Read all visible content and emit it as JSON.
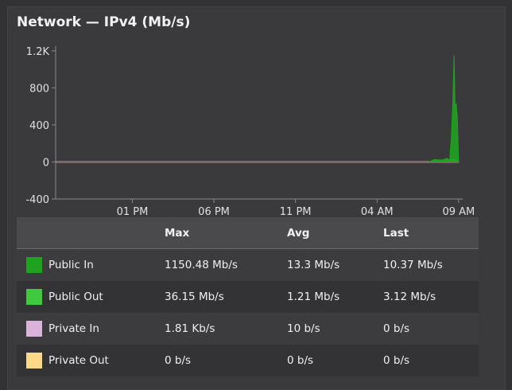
{
  "panel": {
    "title": "Network — IPv4 (Mb/s)"
  },
  "chart_data": {
    "type": "area",
    "title": "Network — IPv4 (Mb/s)",
    "ylim": [
      -400,
      1250
    ],
    "y_ticks": [
      "1.2K",
      "800",
      "400",
      "0",
      "-400"
    ],
    "y_tick_values": [
      1200,
      800,
      400,
      0,
      -400
    ],
    "x_ticks": [
      "01 PM",
      "06 PM",
      "11 PM",
      "04 AM",
      "09 AM"
    ],
    "x_tick_hours": [
      13,
      18,
      23,
      28,
      33
    ],
    "x_range_hours": [
      8.3,
      33.25
    ],
    "grid": false,
    "series": [
      {
        "name": "Public In",
        "color": "#1fa31f",
        "points": [
          [
            8.3,
            0
          ],
          [
            31.2,
            0
          ],
          [
            31.5,
            25
          ],
          [
            32.0,
            20
          ],
          [
            32.3,
            40
          ],
          [
            32.45,
            10
          ],
          [
            32.55,
            250
          ],
          [
            32.65,
            650
          ],
          [
            32.72,
            1150
          ],
          [
            32.78,
            600
          ],
          [
            32.85,
            630
          ],
          [
            32.92,
            480
          ],
          [
            33.0,
            0
          ]
        ]
      },
      {
        "name": "Public Out",
        "color": "#3ec93e",
        "points": [
          [
            8.3,
            0
          ],
          [
            31.2,
            0
          ],
          [
            31.5,
            18
          ],
          [
            32.0,
            14
          ],
          [
            32.5,
            25
          ],
          [
            32.7,
            34
          ],
          [
            33.0,
            8
          ]
        ]
      },
      {
        "name": "Private In",
        "color": "#d9b3d9",
        "points": [
          [
            8.3,
            0
          ],
          [
            33.0,
            0
          ]
        ]
      },
      {
        "name": "Private Out",
        "color": "#ffd98a",
        "points": [
          [
            8.3,
            0
          ],
          [
            33.0,
            0
          ]
        ]
      }
    ]
  },
  "legend": {
    "headers": [
      "",
      "Max",
      "Avg",
      "Last"
    ],
    "rows": [
      {
        "name": "Public In",
        "color": "#1fa31f",
        "max": "1150.48 Mb/s",
        "avg": "13.3 Mb/s",
        "last": "10.37 Mb/s"
      },
      {
        "name": "Public Out",
        "color": "#3ec93e",
        "max": "36.15 Mb/s",
        "avg": "1.21 Mb/s",
        "last": "3.12 Mb/s"
      },
      {
        "name": "Private In",
        "color": "#d9b3d9",
        "max": "1.81 Kb/s",
        "avg": "10 b/s",
        "last": "0 b/s"
      },
      {
        "name": "Private Out",
        "color": "#ffd98a",
        "max": "0 b/s",
        "avg": "0 b/s",
        "last": "0 b/s"
      }
    ]
  }
}
